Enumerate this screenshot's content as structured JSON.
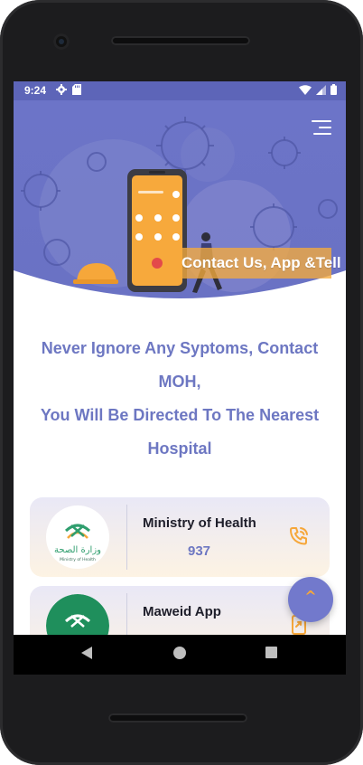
{
  "status_bar": {
    "time": "9:24",
    "left_icons": [
      "settings-gear-icon",
      "sd-card-icon"
    ],
    "right_icons": [
      "wifi-icon",
      "signal-icon",
      "battery-icon"
    ]
  },
  "hero": {
    "title": "Contact Us, App &Tell",
    "menu_icon": "hamburger-menu-icon"
  },
  "intro": {
    "line1": "Never Ignore Any Syptoms, Contact",
    "line2": "MOH,",
    "line3": "You Will Be Directed To The Nearest",
    "line4": "Hospital"
  },
  "contacts": [
    {
      "name": "Ministry of Health",
      "number": "937",
      "logo_caption_ar": "وزارة الصحة",
      "logo_caption_en": "Ministry of Health",
      "action_icon": "phone-ringing-icon"
    },
    {
      "name": "Maweid App",
      "action_icon": "open-app-icon"
    }
  ],
  "fab": {
    "label": "^",
    "icon": "chevron-up-icon"
  },
  "colors": {
    "primary": "#6d77c2",
    "status_bar": "#5d65b8",
    "accent": "#f6a73a",
    "card_top": "#e9e8f6",
    "card_bottom": "#fdf3e3"
  },
  "nav_bar": {
    "buttons": [
      "back-icon",
      "home-icon",
      "recent-apps-icon"
    ]
  }
}
